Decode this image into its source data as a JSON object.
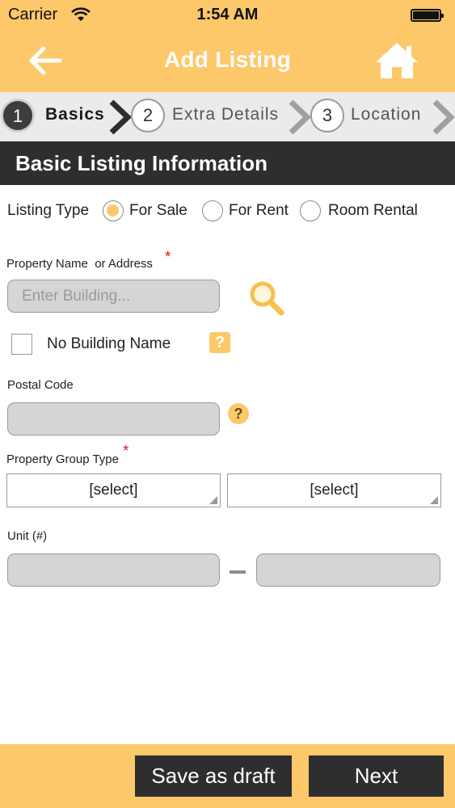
{
  "status_bar": {
    "carrier": "Carrier",
    "time": "1:54 AM"
  },
  "header": {
    "title": "Add Listing",
    "back_icon": "arrow-left-icon",
    "home_icon": "home-icon"
  },
  "steps": [
    {
      "number": "1",
      "label": "Basics",
      "active": true
    },
    {
      "number": "2",
      "label": "Extra Details",
      "active": false
    },
    {
      "number": "3",
      "label": "Location",
      "active": false
    }
  ],
  "section": {
    "title": "Basic Listing Information"
  },
  "listing_type": {
    "label": "Listing Type",
    "options": [
      "For Sale",
      "For Rent",
      "Room Rental"
    ],
    "selected": "For Sale"
  },
  "property_name": {
    "label": "Property Name  or Address",
    "required_mark": "*",
    "placeholder": "Enter Building..."
  },
  "no_building": {
    "label": "No Building Name",
    "help_glyph": "?"
  },
  "postal_code": {
    "label": "Postal Code",
    "help_glyph": "?",
    "value": ""
  },
  "property_group": {
    "label": "Property Group Type",
    "required_mark": "*",
    "select1": "[select]",
    "select2": "[select]"
  },
  "unit": {
    "label": "Unit (#)"
  },
  "footer": {
    "save_draft_label": "Save as draft",
    "next_label": "Next"
  },
  "colors": {
    "accent": "#fcc86a",
    "dark": "#2e2e2e",
    "required": "#d21f1f"
  }
}
